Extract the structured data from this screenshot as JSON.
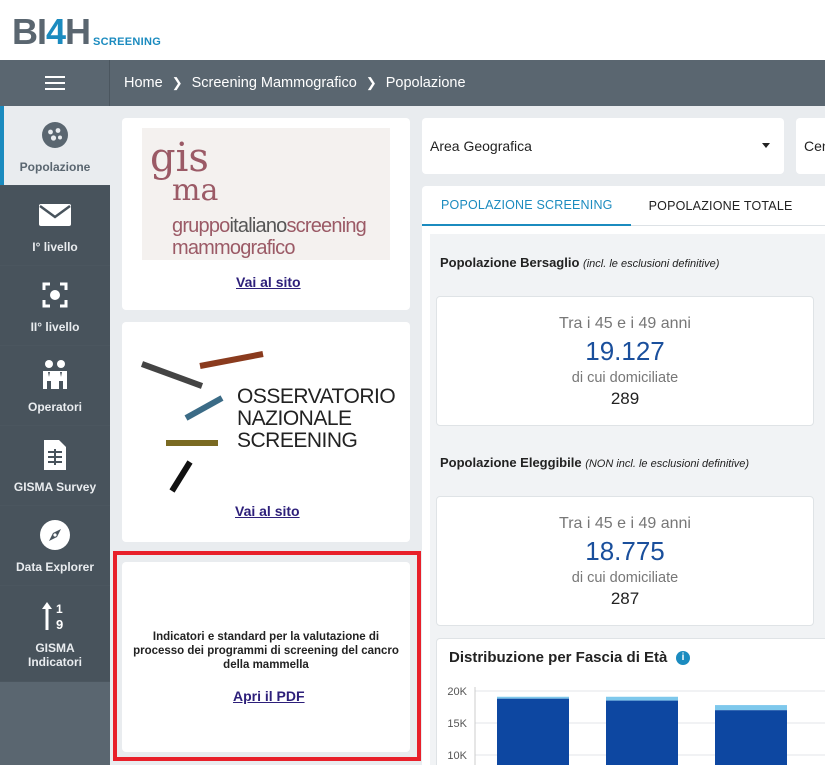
{
  "header": {
    "logo_main_a": "BI",
    "logo_main_b": "4",
    "logo_main_c": "H",
    "logo_sub": "SCREENING"
  },
  "breadcrumb": [
    "Home",
    "Screening Mammografico",
    "Popolazione"
  ],
  "sidebar": {
    "items": [
      {
        "label": "Popolazione",
        "icon": "population-icon",
        "active": true
      },
      {
        "label": "I° livello",
        "icon": "envelope-icon"
      },
      {
        "label": "II° livello",
        "icon": "focus-icon"
      },
      {
        "label": "Operatori",
        "icon": "operators-icon"
      },
      {
        "label": "GISMA Survey",
        "icon": "document-icon"
      },
      {
        "label": "Data Explorer",
        "icon": "compass-icon"
      },
      {
        "label": "GISMA Indicatori",
        "icon": "sort-numeric-icon"
      }
    ]
  },
  "left_cards": {
    "gisma": {
      "logo_line1": "gis",
      "logo_line2": "ma",
      "logo_line3a": "gruppo",
      "logo_line3b": "italiano",
      "logo_line3c": "screening",
      "logo_line4": "mammografico",
      "link": "Vai al sito"
    },
    "ons": {
      "logo_line1": "OSSERVATORIO",
      "logo_line2": "NAZIONALE",
      "logo_line3": "SCREENING",
      "link": "Vai al sito"
    },
    "pdf": {
      "text": "Indicatori e standard per la valutazione di processo dei programmi di screening del cancro della mammella",
      "link": "Apri il PDF"
    }
  },
  "filters": {
    "area": "Area Geografica",
    "second": "Cen"
  },
  "tabs": [
    "POPOLAZIONE SCREENING",
    "POPOLAZIONE TOTALE"
  ],
  "bersaglio": {
    "title": "Popolazione Bersaglio",
    "note": "(incl. le esclusioni definitive)",
    "range": "Tra i 45 e i 49 anni",
    "value": "19.127",
    "sub": "di cui domiciliate",
    "sub_value": "289"
  },
  "eleggibile": {
    "title": "Popolazione Eleggibile",
    "note": "(NON incl. le esclusioni definitive)",
    "range": "Tra i 45 e i 49 anni",
    "value": "18.775",
    "sub": "di cui domiciliate",
    "sub_value": "287"
  },
  "chart_data": {
    "type": "bar",
    "title": "Distribuzione per Fascia di Età",
    "y_ticks": [
      "20K",
      "15K",
      "10K"
    ],
    "ylim": [
      0,
      20000
    ],
    "series": [
      {
        "values": [
          18800,
          18500,
          17000
        ],
        "color": "#0d47a1"
      },
      {
        "values": [
          300,
          600,
          800
        ],
        "color": "#7ec8ec"
      }
    ],
    "colors": {
      "primary": "#0d47a1",
      "secondary": "#7ec8ec"
    }
  },
  "colors": {
    "accent": "#1b8bbf",
    "sidebar": "#5a6670",
    "highlight_frame": "#e8202a"
  }
}
